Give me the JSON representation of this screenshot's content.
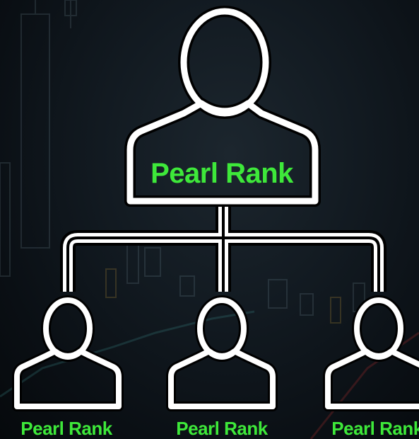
{
  "colors": {
    "background": "#0b1016",
    "outline": "#000000",
    "stroke": "#ffffff",
    "label": "#3ee83a"
  },
  "nodes": {
    "top": {
      "label": "Pearl Rank"
    },
    "children": [
      {
        "label": "Pearl Rank"
      },
      {
        "label": "Pearl Rank"
      },
      {
        "label": "Pearl Rank"
      }
    ]
  }
}
